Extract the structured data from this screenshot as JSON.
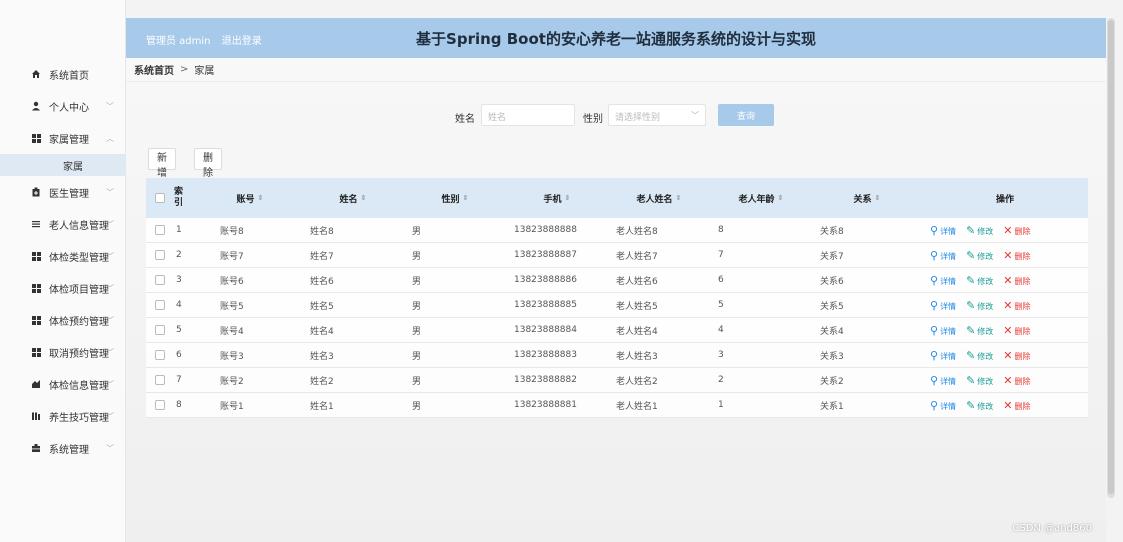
{
  "header": {
    "admin_label": "管理员 admin",
    "logout_label": "退出登录",
    "title": "基于Spring Boot的安心养老一站通服务系统的设计与实现"
  },
  "breadcrumb": {
    "home": "系统首页",
    "separator": ">",
    "current": "家属"
  },
  "sidebar": {
    "items": [
      {
        "label": "系统首页",
        "icon": "home-icon"
      },
      {
        "label": "个人中心",
        "icon": "user-icon"
      },
      {
        "label": "家属管理",
        "icon": "grid-icon",
        "expanded": true
      },
      {
        "label": "医生管理",
        "icon": "doctor-icon"
      },
      {
        "label": "老人信息管理",
        "icon": "list-icon"
      },
      {
        "label": "体检类型管理",
        "icon": "grid-icon"
      },
      {
        "label": "体检项目管理",
        "icon": "grid-icon"
      },
      {
        "label": "体检预约管理",
        "icon": "grid-icon"
      },
      {
        "label": "取消预约管理",
        "icon": "grid-icon"
      },
      {
        "label": "体检信息管理",
        "icon": "chart-icon"
      },
      {
        "label": "养生技巧管理",
        "icon": "book-icon"
      },
      {
        "label": "系统管理",
        "icon": "settings-icon"
      }
    ],
    "submenu": {
      "label": "家属"
    }
  },
  "search": {
    "name_label": "姓名",
    "name_placeholder": "姓名",
    "gender_label": "性别",
    "gender_placeholder": "请选择性别",
    "search_button": "查询"
  },
  "actions": {
    "add": "新增",
    "delete": "删除"
  },
  "table": {
    "headers": [
      "索引",
      "账号",
      "姓名",
      "性别",
      "手机",
      "老人姓名",
      "老人年龄",
      "关系",
      "操作"
    ],
    "ops": {
      "detail": "详情",
      "edit": "修改",
      "delete": "删除"
    },
    "rows": [
      {
        "idx": "1",
        "account": "账号8",
        "name": "姓名8",
        "gender": "男",
        "phone": "13823888888",
        "elder_name": "老人姓名8",
        "elder_age": "8",
        "relation": "关系8"
      },
      {
        "idx": "2",
        "account": "账号7",
        "name": "姓名7",
        "gender": "男",
        "phone": "13823888887",
        "elder_name": "老人姓名7",
        "elder_age": "7",
        "relation": "关系7"
      },
      {
        "idx": "3",
        "account": "账号6",
        "name": "姓名6",
        "gender": "男",
        "phone": "13823888886",
        "elder_name": "老人姓名6",
        "elder_age": "6",
        "relation": "关系6"
      },
      {
        "idx": "4",
        "account": "账号5",
        "name": "姓名5",
        "gender": "男",
        "phone": "13823888885",
        "elder_name": "老人姓名5",
        "elder_age": "5",
        "relation": "关系5"
      },
      {
        "idx": "5",
        "account": "账号4",
        "name": "姓名4",
        "gender": "男",
        "phone": "13823888884",
        "elder_name": "老人姓名4",
        "elder_age": "4",
        "relation": "关系4"
      },
      {
        "idx": "6",
        "account": "账号3",
        "name": "姓名3",
        "gender": "男",
        "phone": "13823888883",
        "elder_name": "老人姓名3",
        "elder_age": "3",
        "relation": "关系3"
      },
      {
        "idx": "7",
        "account": "账号2",
        "name": "姓名2",
        "gender": "男",
        "phone": "13823888882",
        "elder_name": "老人姓名2",
        "elder_age": "2",
        "relation": "关系2"
      },
      {
        "idx": "8",
        "account": "账号1",
        "name": "姓名1",
        "gender": "男",
        "phone": "13823888881",
        "elder_name": "老人姓名1",
        "elder_age": "1",
        "relation": "关系1"
      }
    ]
  },
  "watermark": "CSDN @and860",
  "colors": {
    "header_bg": "#a7c9ea",
    "table_header_bg": "#dbe8f5",
    "submenu_bg": "#dfe9f3",
    "detail_blue": "#1e88e5",
    "edit_teal": "#1a9c96",
    "delete_red": "#e53935"
  }
}
